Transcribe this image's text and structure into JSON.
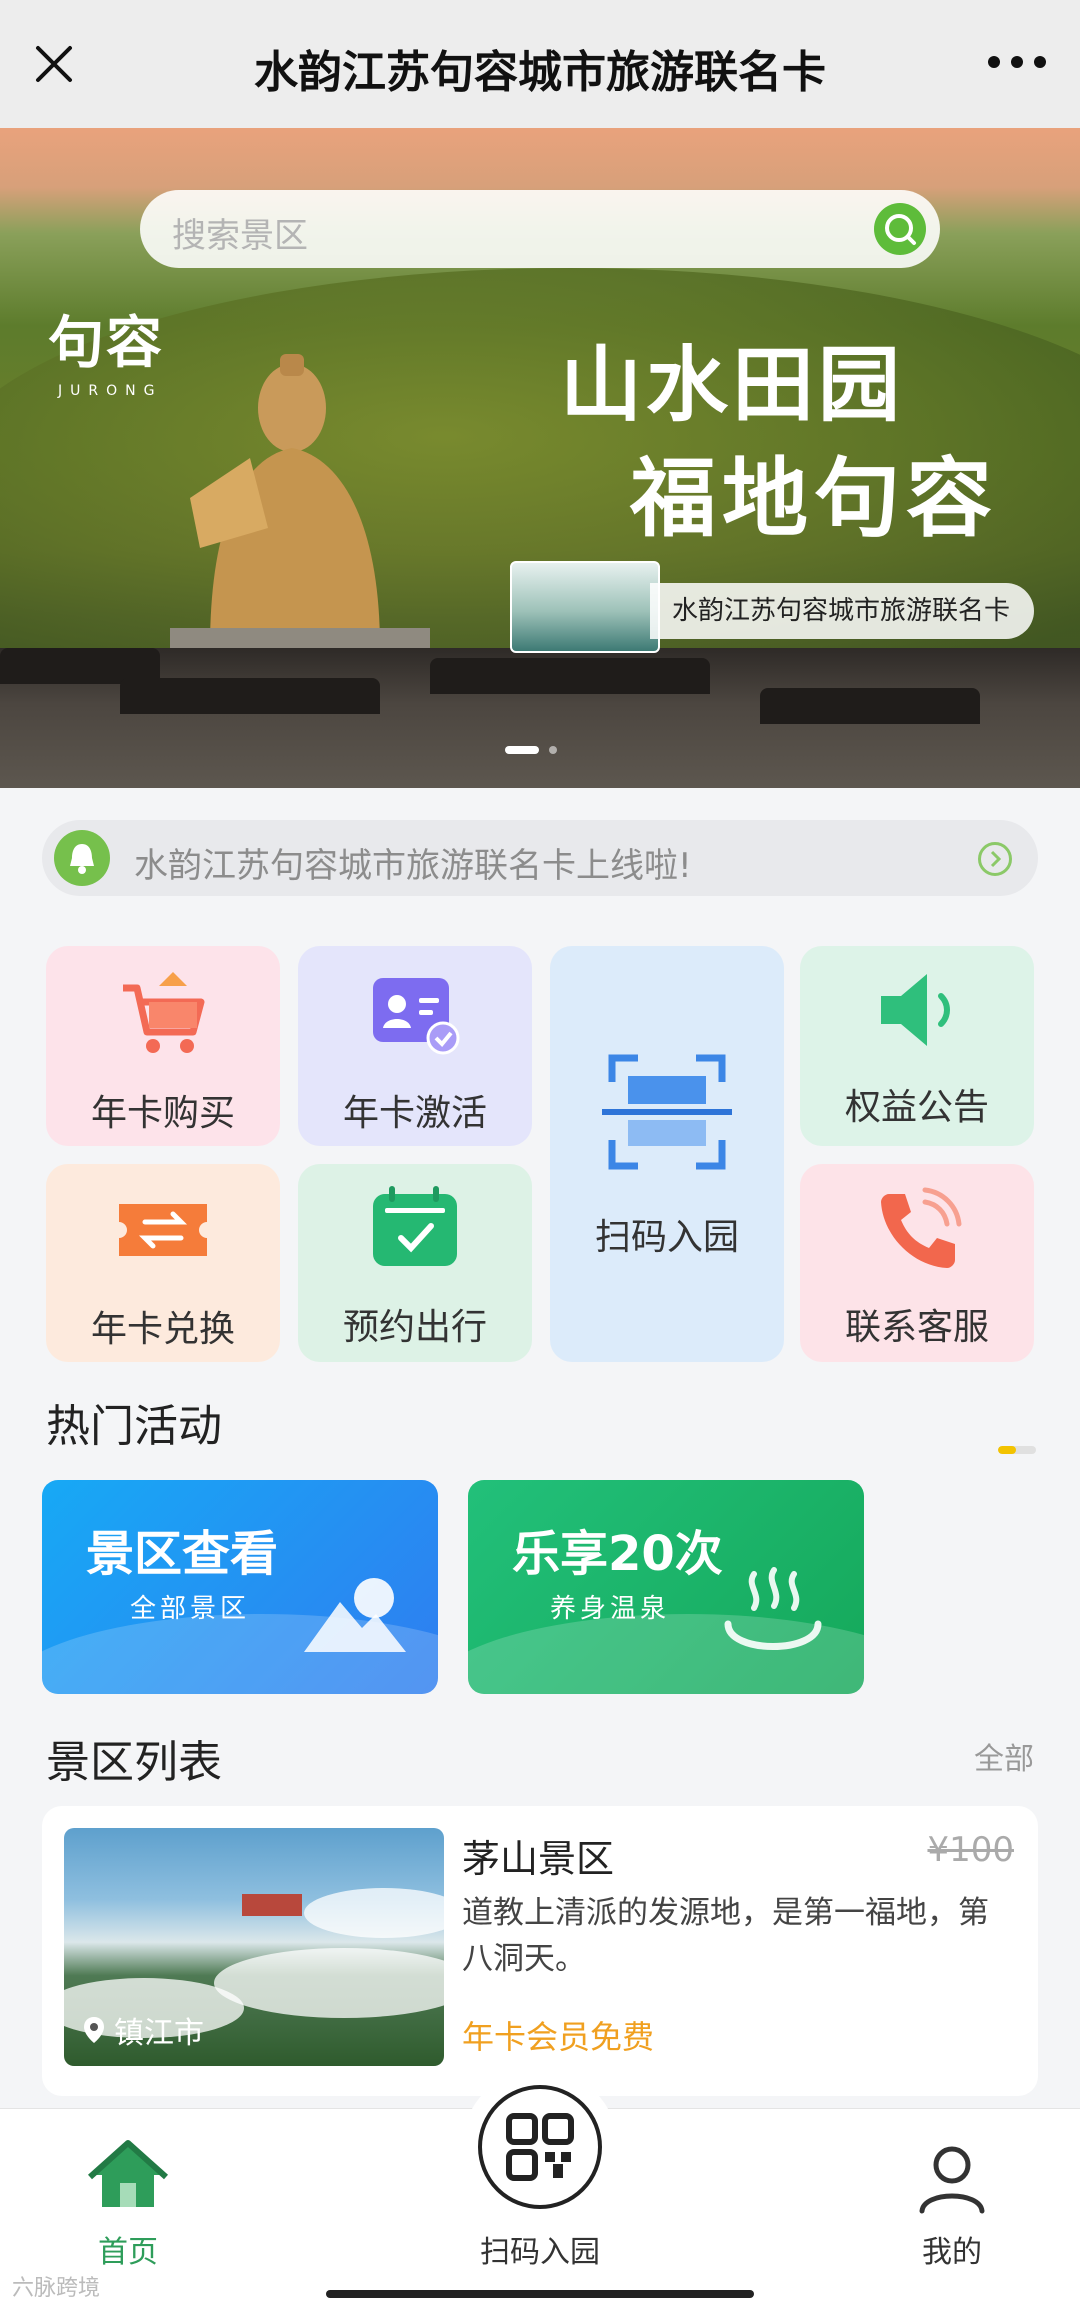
{
  "topbar": {
    "title": "水韵江苏句容城市旅游联名卡"
  },
  "banner": {
    "search_placeholder": "搜索景区",
    "logo_cn": "句容",
    "logo_en": "JURONG",
    "slogan_line1": "山水田园",
    "slogan_line2": "福地句容",
    "card_label": "水韵江苏句容城市旅游联名卡",
    "slides": 2,
    "active_slide": 1
  },
  "notice": {
    "text": "水韵江苏句容城市旅游联名卡上线啦!"
  },
  "grid": [
    {
      "label": "年卡购买",
      "icon": "cart-icon",
      "bg": "#fde3ea"
    },
    {
      "label": "年卡激活",
      "icon": "id-card-check-icon",
      "bg": "#e4e5fb"
    },
    {
      "label": "扫码入园",
      "icon": "scan-icon",
      "bg": "#dcebfa"
    },
    {
      "label": "权益公告",
      "icon": "speaker-icon",
      "bg": "#ddf3e8"
    },
    {
      "label": "年卡兑换",
      "icon": "exchange-ticket-icon",
      "bg": "#fdeadd"
    },
    {
      "label": "预约出行",
      "icon": "calendar-check-icon",
      "bg": "#ddf2e6"
    },
    {
      "label": "联系客服",
      "icon": "phone-icon",
      "bg": "#fde3e8"
    }
  ],
  "hot": {
    "title": "热门活动",
    "cards": [
      {
        "title": "景区查看",
        "subtitle": "全部景区",
        "icon": "mountain-icon",
        "color_from": "#17a9f5",
        "color_to": "#2f7df0"
      },
      {
        "title": "乐享20次",
        "subtitle": "养身温泉",
        "icon": "hot-spring-icon",
        "color_from": "#22c07a",
        "color_to": "#15a85a"
      }
    ]
  },
  "spots": {
    "title": "景区列表",
    "more": "全部",
    "items": [
      {
        "name": "茅山景区",
        "price": "¥100",
        "desc": "道教上清派的发源地，是第一福地，第八洞天。",
        "tag": "年卡会员免费",
        "location": "镇江市"
      }
    ]
  },
  "tabbar": [
    {
      "label": "首页",
      "icon": "home-icon",
      "active": true
    },
    {
      "label": "扫码入园",
      "icon": "qr-code-icon",
      "active": false
    },
    {
      "label": "我的",
      "icon": "user-icon",
      "active": false
    }
  ],
  "watermark": "六脉跨境",
  "colors": {
    "brand_green": "#2e9d5a",
    "search_green": "#5ebc3a",
    "tag_orange": "#f0a020"
  }
}
